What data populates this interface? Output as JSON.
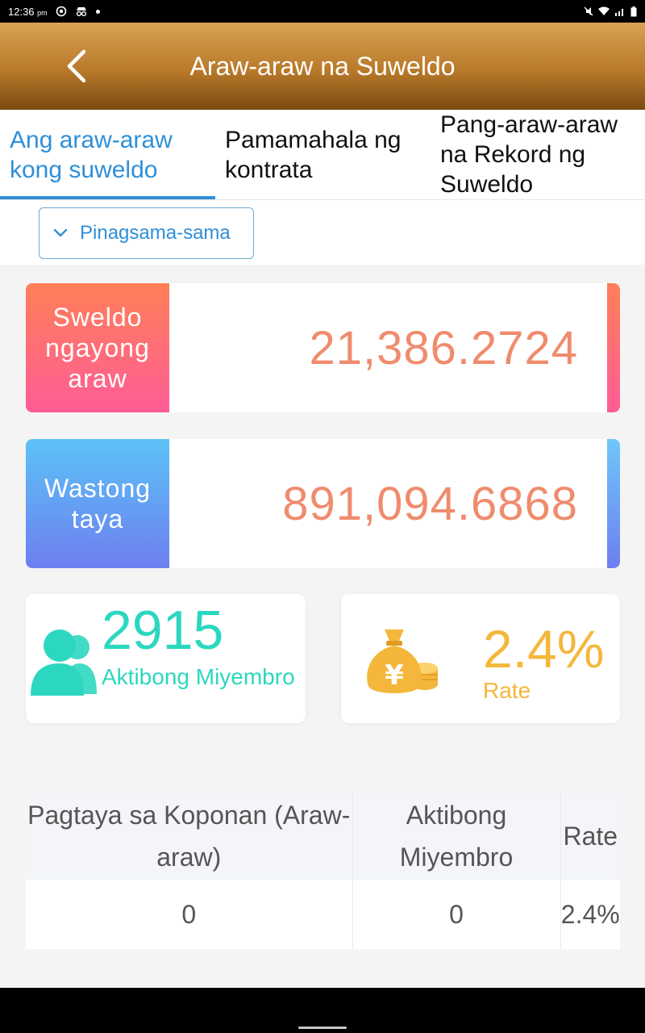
{
  "status_bar": {
    "time": "12:36",
    "ampm": "pm"
  },
  "header": {
    "title": "Araw-araw na Suweldo"
  },
  "tabs": [
    {
      "label": "Ang araw-araw kong suweldo"
    },
    {
      "label": "Pamamahala ng kontrata"
    },
    {
      "label": "Pang-araw-araw na Rekord ng Suweldo"
    }
  ],
  "filter": {
    "selected": "Pinagsama-sama"
  },
  "stats": {
    "salary_today": {
      "label": "Sweldo ngayong araw",
      "value": "21,386.2724"
    },
    "valid_bet": {
      "label": "Wastong taya",
      "value": "891,094.6868"
    }
  },
  "members": {
    "value": "2915",
    "label": "Aktibong Miyembro"
  },
  "rate": {
    "value": "2.4%",
    "label": "Rate"
  },
  "table": {
    "headers": [
      "Pagtaya sa Koponan (Araw-araw)",
      "Aktibong Miyembro",
      "Rate"
    ],
    "rows": [
      [
        "0",
        "0",
        "2.4%"
      ]
    ]
  },
  "colors": {
    "accent_blue": "#2f8fd8",
    "header_gold": "#b97a2a",
    "member_teal": "#2cd7c0",
    "rate_gold": "#f4b73b",
    "value_orange": "#ef8c6e"
  }
}
